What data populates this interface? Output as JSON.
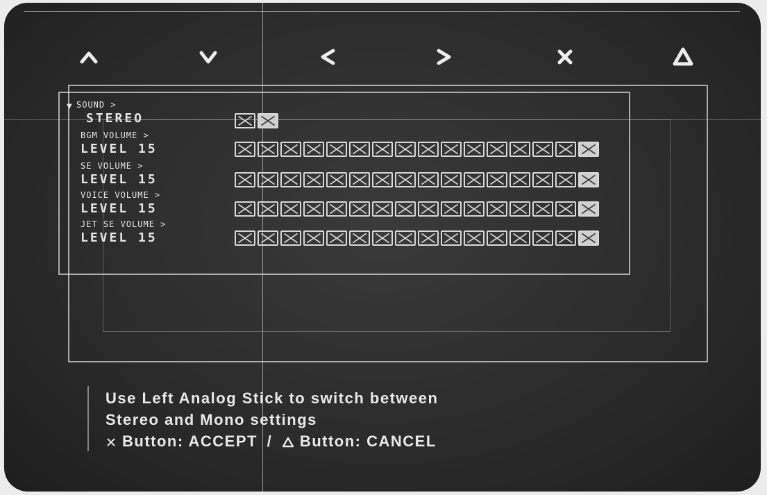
{
  "controller_buttons": [
    {
      "name": "up",
      "glyph": "up-chevron"
    },
    {
      "name": "down",
      "glyph": "down-chevron"
    },
    {
      "name": "left",
      "glyph": "left-chevron"
    },
    {
      "name": "right",
      "glyph": "right-chevron"
    },
    {
      "name": "cross",
      "glyph": "cross"
    },
    {
      "name": "triangle",
      "glyph": "triangle"
    }
  ],
  "menu": {
    "section_label": "SOUND >",
    "stereo": {
      "label": "STEREO",
      "cells": 2,
      "selected": 2
    },
    "volumes": [
      {
        "label": "BGM VOLUME >",
        "level_text": "LEVEL 15",
        "cells": 16,
        "level": 15
      },
      {
        "label": "SE VOLUME >",
        "level_text": "LEVEL 15",
        "cells": 16,
        "level": 15
      },
      {
        "label": "VOICE VOLUME >",
        "level_text": "LEVEL 15",
        "cells": 16,
        "level": 15
      },
      {
        "label": "JET SE VOLUME >",
        "level_text": "LEVEL 15",
        "cells": 16,
        "level": 15
      }
    ]
  },
  "help": {
    "line1": "Use Left Analog Stick to switch between",
    "line2": "Stereo and Mono settings",
    "line3_accept": "Button: ACCEPT",
    "line3_sep": "/",
    "line3_cancel": "Button: CANCEL"
  },
  "colors": {
    "background": "#2c2c2c",
    "foreground": "#e4e4e4"
  }
}
